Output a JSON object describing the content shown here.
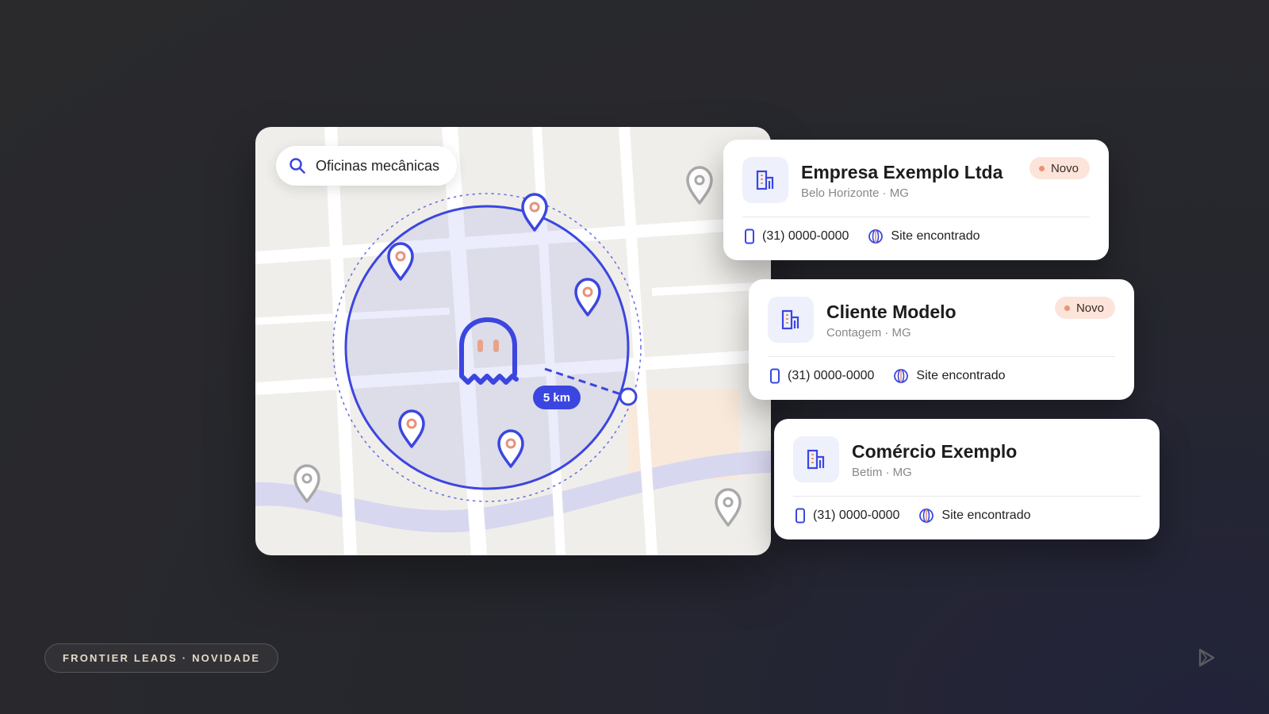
{
  "search": {
    "query": "Oficinas mecânicas"
  },
  "map": {
    "radius_label": "5 km"
  },
  "leads": [
    {
      "name": "Empresa Exemplo Ltda",
      "location": "Belo Horizonte · MG",
      "badge": "Novo",
      "phone": "(31) 0000-0000",
      "site": "Site encontrado"
    },
    {
      "name": "Cliente Modelo",
      "location": "Contagem · MG",
      "badge": "Novo",
      "phone": "(31) 0000-0000",
      "site": "Site encontrado"
    },
    {
      "name": "Comércio Exemplo",
      "location": "Betim · MG",
      "phone": "(31) 0000-0000",
      "site": "Site encontrado"
    }
  ],
  "footer": {
    "tag": "FRONTIER LEADS · NOVIDADE"
  },
  "colors": {
    "accent": "#3b46e0",
    "badge_bg": "#fce4da",
    "badge_dot": "#e79476",
    "background": "#2a2a2d"
  },
  "icons": [
    "search-icon",
    "building-icon",
    "phone-icon",
    "globe-icon",
    "map-pin-icon",
    "ghost-icon",
    "brand-logo-icon"
  ]
}
